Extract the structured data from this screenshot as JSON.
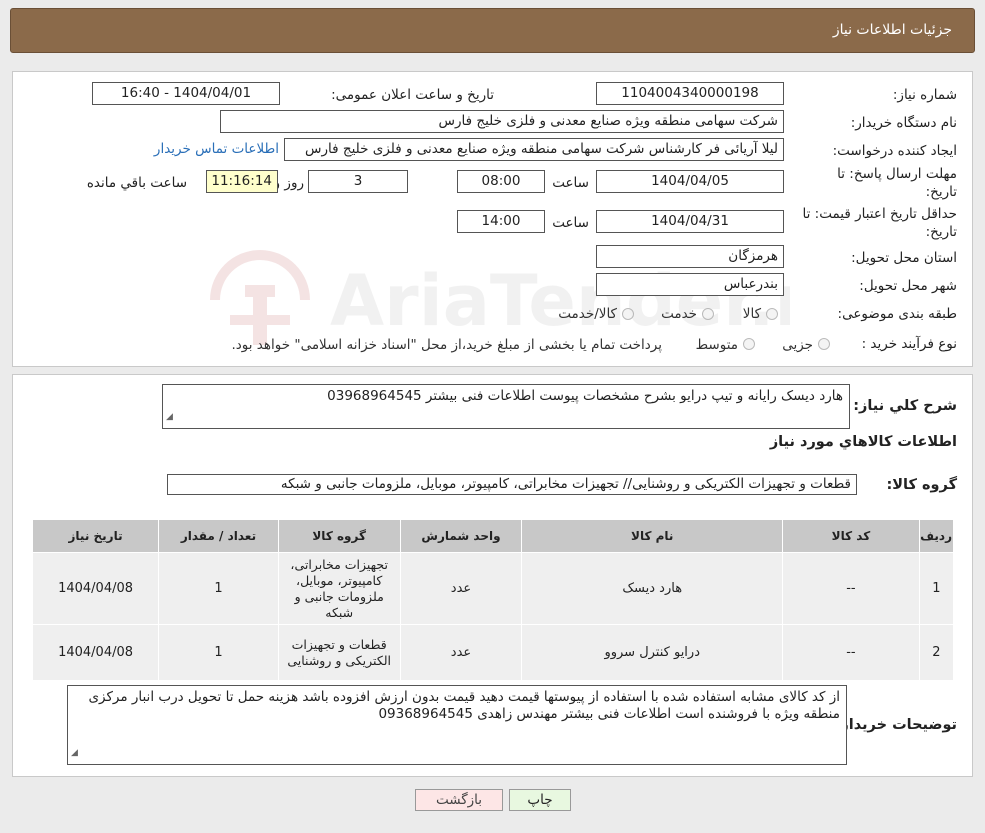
{
  "header": {
    "title": "جزئیات اطلاعات نیاز"
  },
  "need_info": {
    "need_number_label": "شماره نیاز:",
    "need_number": "1104004340000198",
    "announce_label": "تاریخ و ساعت اعلان عمومی:",
    "announce_value": "1404/04/01 - 16:40",
    "buyer_org_label": "نام دستگاه خریدار:",
    "buyer_org": "شرکت سهامی منطقه ویژه صنایع معدنی و فلزی خلیج فارس",
    "creator_label": "ایجاد کننده درخواست:",
    "creator": "لیلا آریائی فر کارشناس شرکت سهامی منطقه ویژه صنایع معدنی و فلزی خلیج فارس",
    "contact_link": "اطلاعات تماس خریدار",
    "deadline_label_line1": "مهلت ارسال پاسخ: تا",
    "deadline_label_line2": "تاریخ:",
    "deadline_date": "1404/04/05",
    "time_label": "ساعت",
    "deadline_time": "08:00",
    "days_value": "3",
    "days_label": "روز و",
    "remaining_time": "11:16:14",
    "remaining_label": "ساعت باقي مانده",
    "validity_label_line1": "حداقل تاریخ اعتبار قیمت: تا",
    "validity_label_line2": "تاریخ:",
    "validity_date": "1404/04/31",
    "validity_time_label": "ساعت",
    "validity_time": "14:00",
    "province_label": "استان محل تحویل:",
    "province": "هرمزگان",
    "city_label": "شهر محل تحویل:",
    "city": "بندرعباس",
    "category_label": "طبقه بندی موضوعی:",
    "category_options": [
      "کالا",
      "خدمت",
      "کالا/خدمت"
    ],
    "process_label": "نوع فرآیند خرید :",
    "process_options": [
      "جزیی",
      "متوسط"
    ],
    "process_note": "پرداخت تمام یا بخشی از مبلغ خرید،از محل \"اسناد خزانه اسلامی\" خواهد بود."
  },
  "watermark": {
    "text": "AriaTender.neT"
  },
  "details": {
    "summary_label": "شرح کلي نياز:",
    "summary": "هارد دیسک رایانه و تیپ درایو بشرح مشخصات پیوست اطلاعات فنی بیشتر 03968964545",
    "goods_info_title": "اطلاعات کالاهاي مورد نياز",
    "group_label": "گروه کالا:",
    "group_value": "قطعات و تجهیزات الکتریکی و روشنایی// تجهیزات مخابراتی، کامپیوتر، موبایل، ملزومات جانبی و شبکه",
    "table": {
      "headers": [
        "رديف",
        "کد کالا",
        "نام کالا",
        "واحد شمارش",
        "گروه کالا",
        "تعداد / مقدار",
        "تاریخ نیاز"
      ],
      "rows": [
        {
          "row": "1",
          "code": "--",
          "name": "هارد دیسک",
          "unit": "عدد",
          "group": "تجهیزات مخابراتی، کامپیوتر، موبایل، ملزومات جانبی و شبکه",
          "qty": "1",
          "date": "1404/04/08"
        },
        {
          "row": "2",
          "code": "--",
          "name": "درایو کنترل سروو",
          "unit": "عدد",
          "group": "قطعات و تجهیزات الکتریکی و روشنایی",
          "qty": "1",
          "date": "1404/04/08"
        }
      ]
    },
    "buyer_notes_label": "توضیحات خریدار:",
    "buyer_notes": "از کد کالای مشابه استفاده شده با استفاده از پیوستها قیمت دهید  قیمت بدون ارزش افزوده باشد هزینه حمل تا تحویل درب انبار مرکزی منطقه ویژه با فروشنده است اطلاعات فنی بیشتر مهندس زاهدی 09368964545"
  },
  "buttons": {
    "print": "چاپ",
    "back": "بازگشت"
  },
  "colors": {
    "header_bg": "#8b6a4a",
    "link": "#2a6fb8",
    "yellow_box": "#ffffcc",
    "back_btn_bg": "#fde6e6",
    "print_btn_bg": "#e8f8e0"
  }
}
